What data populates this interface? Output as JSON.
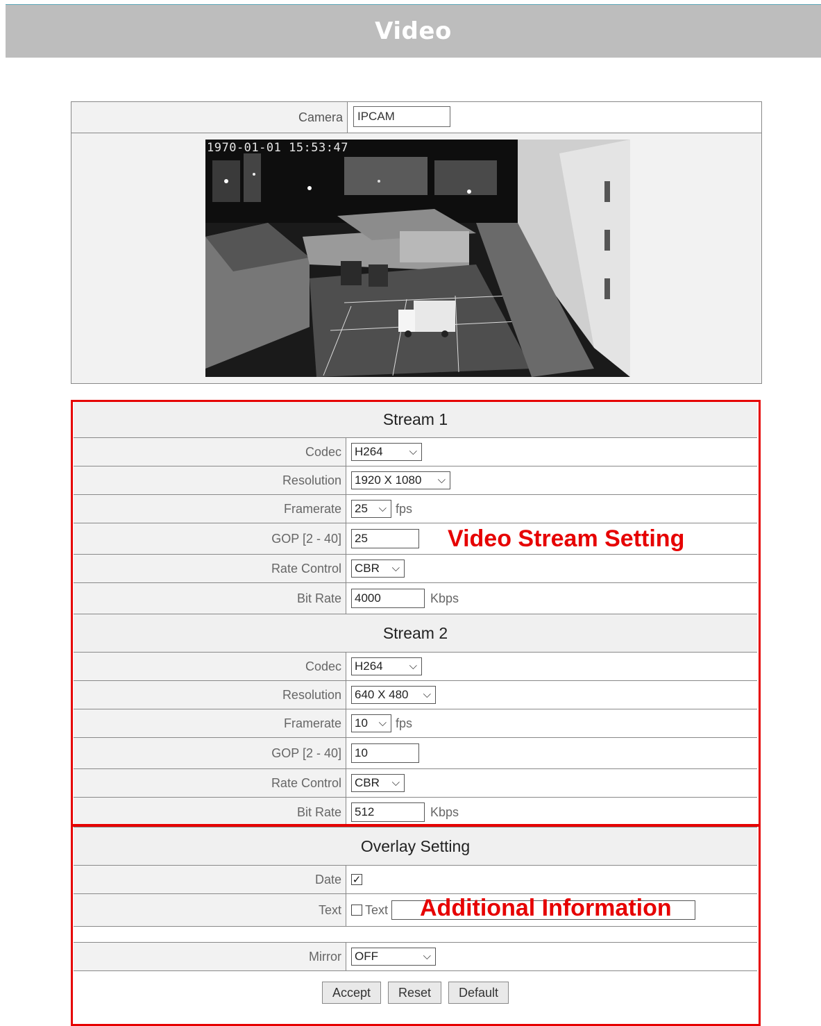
{
  "header": {
    "title": "Video"
  },
  "camera": {
    "label": "Camera",
    "value": "IPCAM",
    "timestamp": "1970-01-01 15:53:47"
  },
  "stream1": {
    "title": "Stream 1",
    "codec_label": "Codec",
    "codec": "H264",
    "resolution_label": "Resolution",
    "resolution": "1920 X 1080",
    "framerate_label": "Framerate",
    "framerate": "25",
    "framerate_unit": "fps",
    "gop_label": "GOP [2 - 40]",
    "gop": "25",
    "rate_control_label": "Rate Control",
    "rate_control": "CBR",
    "bitrate_label": "Bit Rate",
    "bitrate": "4000",
    "bitrate_unit": "Kbps"
  },
  "stream2": {
    "title": "Stream 2",
    "codec_label": "Codec",
    "codec": "H264",
    "resolution_label": "Resolution",
    "resolution": "640 X 480",
    "framerate_label": "Framerate",
    "framerate": "10",
    "framerate_unit": "fps",
    "gop_label": "GOP [2 - 40]",
    "gop": "10",
    "rate_control_label": "Rate Control",
    "rate_control": "CBR",
    "bitrate_label": "Bit Rate",
    "bitrate": "512",
    "bitrate_unit": "Kbps"
  },
  "overlay": {
    "title": "Overlay Setting",
    "date_label": "Date",
    "date_checked": true,
    "text_label": "Text",
    "text_checkbox_label": "Text",
    "text_checked": false,
    "text_value": ""
  },
  "mirror": {
    "label": "Mirror",
    "value": "OFF"
  },
  "buttons": {
    "accept": "Accept",
    "reset": "Reset",
    "default": "Default"
  },
  "annotations": {
    "video_stream": "Video Stream Setting",
    "additional": "Additional Information"
  },
  "colors": {
    "annotation": "#e60000",
    "banner": "#bdbdbd"
  }
}
